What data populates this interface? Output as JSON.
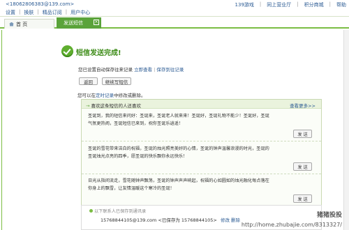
{
  "header": {
    "email": "<18062806383@139.com>",
    "links": [
      "设置",
      "换肤",
      "精品订阅",
      "用户中心"
    ],
    "right_links": [
      "139游戏",
      "同上营业厅",
      "积分商城",
      "帮助"
    ]
  },
  "tabs": {
    "home": "首 页",
    "active": "发送短信",
    "close": "×"
  },
  "result": {
    "title": "短信发送完成!",
    "saved_text": "您已设置自动保存往来记录",
    "view_now": "立即查看",
    "save_setting": "保存到往记录"
  },
  "buttons": {
    "back": "返回",
    "continue": "继续写短信"
  },
  "timing": {
    "text": "您可以在",
    "link": "定时记录",
    "rest": "中修改或删除。"
  },
  "greetings": {
    "title": "喜欢这条短信的人还喜欢",
    "view_more": "查看更多>>",
    "items": [
      {
        "text": "圣诞到，我的短信来问好：圣诞来，圣诞老人就来来！圣诞好，圣诞礼物不能少！圣诞好，圣诞气氛更热闹，圣诞短信已来到，祝你圣诞乐逍遥！",
        "send": "发 送"
      },
      {
        "text": "圣诞的雪花带来洁白的祝福，圣诞的烛光照亮美好的心情，圣诞的钟声温馨浪漫的时光，圣诞的圣诞烛光点亮的四季，愿圣诞的快乐飘你永远快乐！",
        "send": "发 送"
      },
      {
        "text": "日光从指间流走，雪花随钟声飘荡，圣诞的钟声声声响起，祝福的心如圆如的烛光融化每点落在你身上的飘雪，让友情温暖这个寒冷的圣诞！",
        "send": "发 送"
      }
    ]
  },
  "contacts": {
    "label": "以下联系人已保存到通讯录",
    "line": "15768844105@139.com <已保存为 15768844105>",
    "modify": "修改",
    "delete": "删除"
  },
  "watermark": {
    "logo": "猪猪投投",
    "url": "http://home.zhubajie.com/8313327/"
  }
}
